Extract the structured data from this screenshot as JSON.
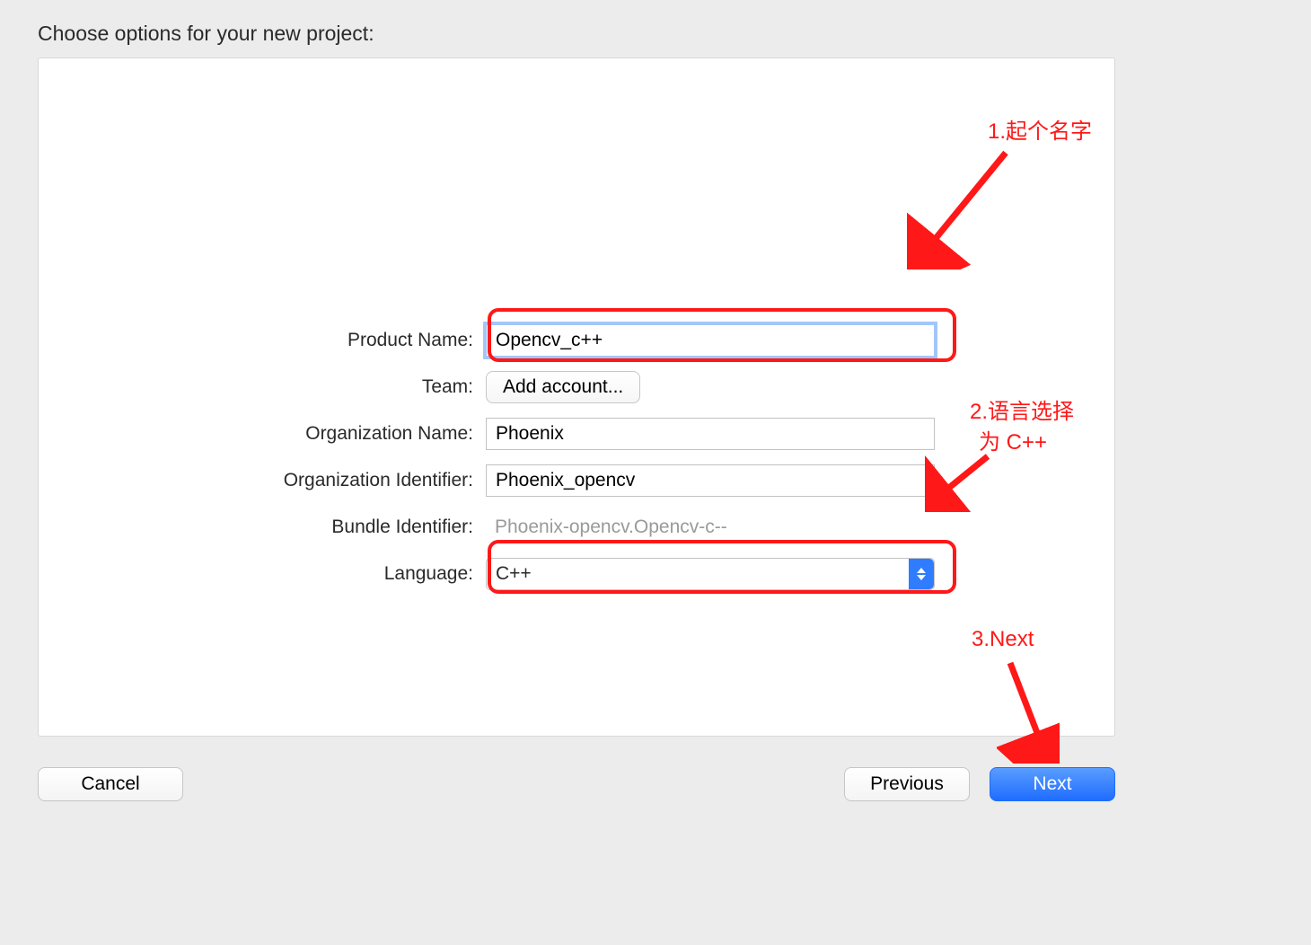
{
  "title": "Choose options for your new project:",
  "form": {
    "product_name": {
      "label": "Product Name:",
      "value": "Opencv_c++"
    },
    "team": {
      "label": "Team:",
      "button": "Add account..."
    },
    "org_name": {
      "label": "Organization Name:",
      "value": "Phoenix"
    },
    "org_id": {
      "label": "Organization Identifier:",
      "value": "Phoenix_opencv"
    },
    "bundle_id": {
      "label": "Bundle Identifier:",
      "value": "Phoenix-opencv.Opencv-c--"
    },
    "language": {
      "label": "Language:",
      "value": "C++"
    }
  },
  "buttons": {
    "cancel": "Cancel",
    "previous": "Previous",
    "next": "Next"
  },
  "annotations": {
    "a1": "1.起个名字",
    "a2_line1": "2.语言选择",
    "a2_line2": "为 C++",
    "a3": "3.Next"
  }
}
